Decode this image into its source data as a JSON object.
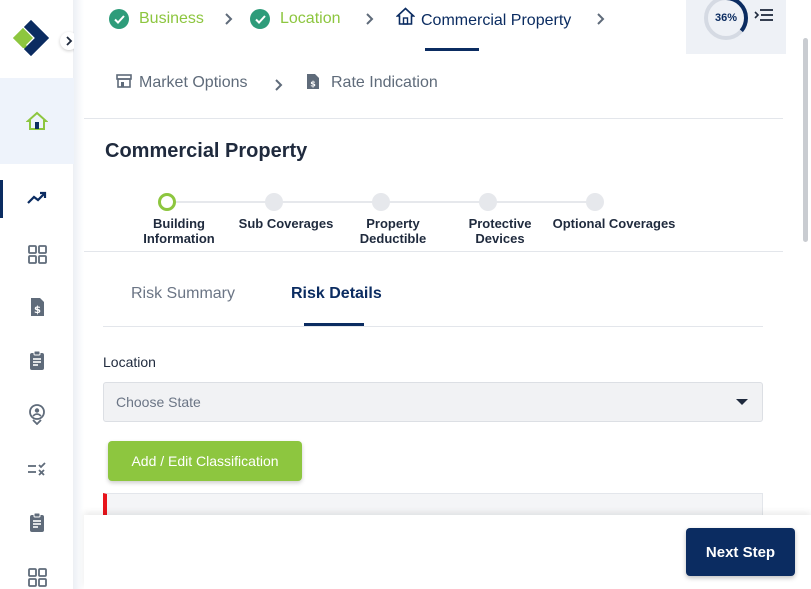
{
  "breadcrumbs": [
    {
      "label": "Business",
      "state": "done"
    },
    {
      "label": "Location",
      "state": "done"
    },
    {
      "label": "Commercial Property",
      "state": "current"
    }
  ],
  "breadcrumbs_row2": [
    {
      "label": "Market Options"
    },
    {
      "label": "Rate Indication"
    }
  ],
  "progress": {
    "text": "36%",
    "value": 0.36
  },
  "page_title": "Commercial Property",
  "stepper": [
    {
      "label": "Building Information",
      "state": "active"
    },
    {
      "label": "Sub Coverages",
      "state": "pending"
    },
    {
      "label": "Property Deductible",
      "state": "pending"
    },
    {
      "label": "Protective Devices",
      "state": "pending"
    },
    {
      "label": "Optional Coverages",
      "state": "pending"
    }
  ],
  "tabs": [
    {
      "label": "Risk Summary",
      "active": false
    },
    {
      "label": "Risk Details",
      "active": true
    }
  ],
  "location": {
    "label": "Location",
    "placeholder": "Choose State"
  },
  "add_button_label": "Add / Edit Classification",
  "next_button_label": "Next Step",
  "colors": {
    "brand_navy": "#0b2c61",
    "brand_green": "#8dc63f",
    "check_green": "#2e9c7a",
    "alert_red": "#e8141b"
  },
  "sidebar_icons": [
    "home-icon",
    "trending-icon",
    "grid-icon",
    "invoice-icon",
    "clipboard-icon",
    "location-pin-icon",
    "checklist-icon",
    "clipboard-icon",
    "grid-icon"
  ]
}
